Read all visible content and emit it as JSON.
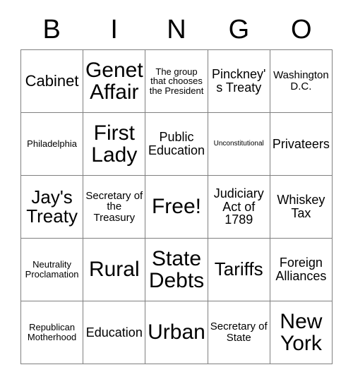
{
  "card": {
    "header_letters": [
      "B",
      "I",
      "N",
      "G",
      "O"
    ],
    "free_space_label": "Free!",
    "rows": [
      [
        {
          "text": "Cabinet",
          "size": "lg"
        },
        {
          "text": "Genet Affair",
          "size": "xxl"
        },
        {
          "text": "The group that chooses the President",
          "size": "xs"
        },
        {
          "text": "Pinckney's Treaty",
          "size": "md"
        },
        {
          "text": "Washington D.C.",
          "size": "sm"
        }
      ],
      [
        {
          "text": "Philadelphia",
          "size": "xs"
        },
        {
          "text": "First Lady",
          "size": "xxl"
        },
        {
          "text": "Public Education",
          "size": "md"
        },
        {
          "text": "Unconstitutional",
          "size": "xxs"
        },
        {
          "text": "Privateers",
          "size": "md"
        }
      ],
      [
        {
          "text": "Jay's Treaty",
          "size": "xl"
        },
        {
          "text": "Secretary of the Treasury",
          "size": "sm"
        },
        {
          "text": "Free!",
          "size": "xxl"
        },
        {
          "text": "Judiciary Act of 1789",
          "size": "md"
        },
        {
          "text": "Whiskey Tax",
          "size": "md"
        }
      ],
      [
        {
          "text": "Neutrality Proclamation",
          "size": "xs"
        },
        {
          "text": "Rural",
          "size": "xxl"
        },
        {
          "text": "State Debts",
          "size": "xxl"
        },
        {
          "text": "Tariffs",
          "size": "xl"
        },
        {
          "text": "Foreign Alliances",
          "size": "md"
        }
      ],
      [
        {
          "text": "Republican Motherhood",
          "size": "xs"
        },
        {
          "text": "Education",
          "size": "md"
        },
        {
          "text": "Urban",
          "size": "xxl"
        },
        {
          "text": "Secretary of State",
          "size": "sm"
        },
        {
          "text": "New York",
          "size": "xxl"
        }
      ]
    ]
  },
  "colors": {
    "background": "#ffffff",
    "text": "#000000",
    "grid_line": "#808080"
  }
}
